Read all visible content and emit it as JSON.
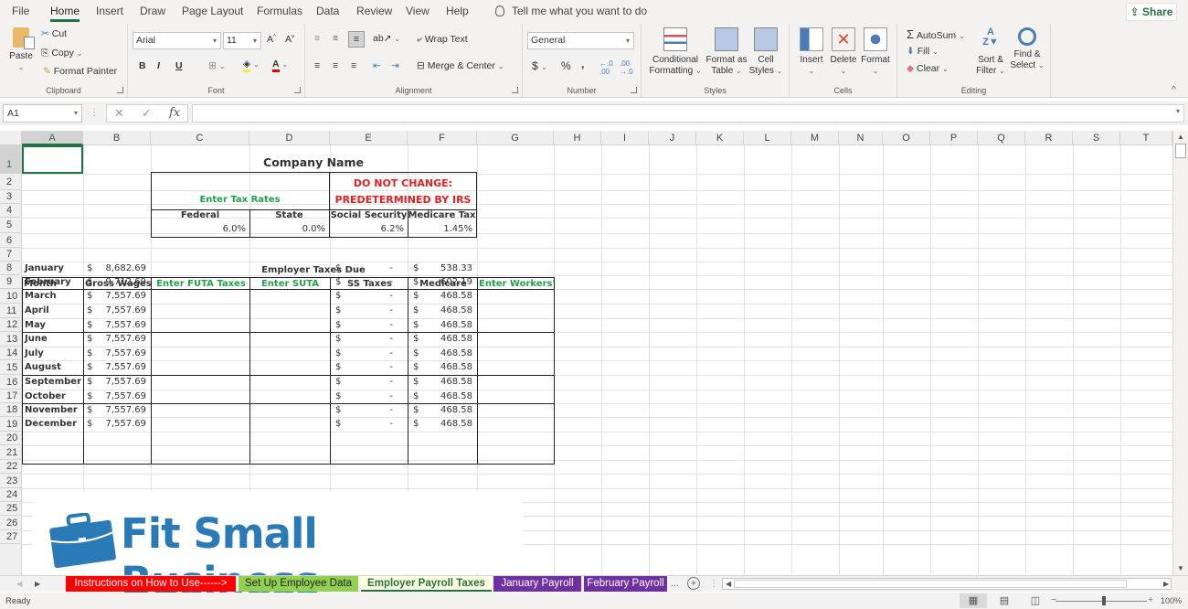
{
  "ribbon": {
    "tabs": [
      "File",
      "Home",
      "Insert",
      "Draw",
      "Page Layout",
      "Formulas",
      "Data",
      "Review",
      "View",
      "Help"
    ],
    "active_tab": "Home",
    "tell_me": "Tell me what you want to do",
    "share": "Share",
    "clipboard": {
      "label": "Clipboard",
      "paste": "Paste",
      "cut": "Cut",
      "copy": "Copy",
      "format_painter": "Format Painter"
    },
    "font": {
      "label": "Font",
      "font_name": "Arial",
      "font_size": "11",
      "bold": "B",
      "italic": "I",
      "underline": "U"
    },
    "alignment": {
      "label": "Alignment",
      "wrap_text": "Wrap Text",
      "merge_center": "Merge & Center"
    },
    "number": {
      "label": "Number",
      "format": "General",
      "currency": "$",
      "percent": "%",
      "comma": ","
    },
    "styles": {
      "label": "Styles",
      "conditional_1": "Conditional",
      "conditional_2": "Formatting",
      "format_table_1": "Format as",
      "format_table_2": "Table",
      "cell_styles_1": "Cell",
      "cell_styles_2": "Styles"
    },
    "cells": {
      "label": "Cells",
      "insert": "Insert",
      "delete": "Delete",
      "format": "Format"
    },
    "editing": {
      "label": "Editing",
      "autosum": "AutoSum",
      "fill": "Fill",
      "clear": "Clear",
      "sort_1": "Sort &",
      "sort_2": "Filter",
      "find_1": "Find &",
      "find_2": "Select"
    }
  },
  "formula_bar": {
    "name_box": "A1",
    "formula": ""
  },
  "columns": [
    "A",
    "B",
    "C",
    "D",
    "E",
    "F",
    "G",
    "H",
    "I",
    "J",
    "K",
    "L",
    "M",
    "N",
    "O",
    "P",
    "Q",
    "R",
    "S",
    "T"
  ],
  "rows": [
    "1",
    "2",
    "3",
    "4",
    "5",
    "6",
    "7",
    "8",
    "9",
    "10",
    "11",
    "12",
    "13",
    "14",
    "15",
    "16",
    "17",
    "18",
    "19",
    "20",
    "21",
    "22",
    "23",
    "24",
    "25",
    "26",
    "27"
  ],
  "sheet": {
    "company_name": "Company Name",
    "enter_tax_rates": "Enter Tax Rates",
    "do_not_change_1": "DO NOT CHANGE:",
    "do_not_change_2": "PREDETERMINED BY IRS",
    "rate_headers": [
      "Federal",
      "State",
      "Social Security",
      "Medicare Tax"
    ],
    "rate_values": [
      "6.0%",
      "0.0%",
      "6.2%",
      "1.45%"
    ],
    "employer_taxes_due": "Employer Taxes Due",
    "table_headers": [
      "Month",
      "Gross Wages",
      "Enter FUTA Taxes",
      "Enter SUTA",
      "SS Taxes",
      "Medicare",
      "Enter Workers'"
    ],
    "currency_symbol": "$",
    "dash": "-",
    "months": [
      {
        "month": "January",
        "gross": "8,682.69",
        "medicare": "538.33"
      },
      {
        "month": "February",
        "gross": "9,712.69",
        "medicare": "602.19"
      },
      {
        "month": "March",
        "gross": "7,557.69",
        "medicare": "468.58"
      },
      {
        "month": "April",
        "gross": "7,557.69",
        "medicare": "468.58"
      },
      {
        "month": "May",
        "gross": "7,557.69",
        "medicare": "468.58"
      },
      {
        "month": "June",
        "gross": "7,557.69",
        "medicare": "468.58"
      },
      {
        "month": "July",
        "gross": "7,557.69",
        "medicare": "468.58"
      },
      {
        "month": "August",
        "gross": "7,557.69",
        "medicare": "468.58"
      },
      {
        "month": "September",
        "gross": "7,557.69",
        "medicare": "468.58"
      },
      {
        "month": "October",
        "gross": "7,557.69",
        "medicare": "468.58"
      },
      {
        "month": "November",
        "gross": "7,557.69",
        "medicare": "468.58"
      },
      {
        "month": "December",
        "gross": "7,557.69",
        "medicare": "468.58"
      }
    ]
  },
  "logo": {
    "text": "Fit Small Business",
    "color": "#2a7ab8"
  },
  "sheet_tabs": [
    {
      "label": "Instructions on How to Use------>",
      "bg": "#ff0000",
      "fg": "#ffffff"
    },
    {
      "label": "Set Up Employee Data",
      "bg": "#92d050",
      "fg": "#222222"
    },
    {
      "label": "Employer Payroll Taxes",
      "bg": "#ffffe0",
      "fg": "#217346",
      "active": true
    },
    {
      "label": "January Payroll",
      "bg": "#7030a0",
      "fg": "#ffffff"
    },
    {
      "label": "February Payroll",
      "bg": "#7030a0",
      "fg": "#ffffff"
    }
  ],
  "sheet_tabs_more": "...",
  "status": {
    "ready": "Ready",
    "zoom": "100%"
  }
}
